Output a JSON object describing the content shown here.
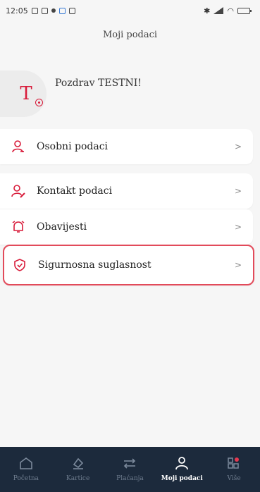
{
  "status_bar": {
    "time": "12:05"
  },
  "header": {
    "title": "Moji podaci"
  },
  "profile": {
    "initial": "T",
    "greeting": "Pozdrav TESTNI!"
  },
  "menu": [
    {
      "label": "Osobni podaci",
      "chevron": ">"
    },
    {
      "label": "Kontakt podaci",
      "chevron": ">"
    },
    {
      "label": "Obavijesti",
      "chevron": ">"
    },
    {
      "label": "Sigurnosna suglasnost",
      "chevron": ">"
    }
  ],
  "bottom_nav": [
    {
      "label": "Početna",
      "icon": "home-icon"
    },
    {
      "label": "Kartice",
      "icon": "card-icon"
    },
    {
      "label": "Plaćanja",
      "icon": "transfer-icon"
    },
    {
      "label": "Moji podaci",
      "icon": "user-icon",
      "active": true
    },
    {
      "label": "Više",
      "icon": "more-icon"
    }
  ],
  "colors": {
    "accent": "#d81b3a",
    "highlight_border": "#e24a5a",
    "nav_bg": "#1c2a3c"
  }
}
